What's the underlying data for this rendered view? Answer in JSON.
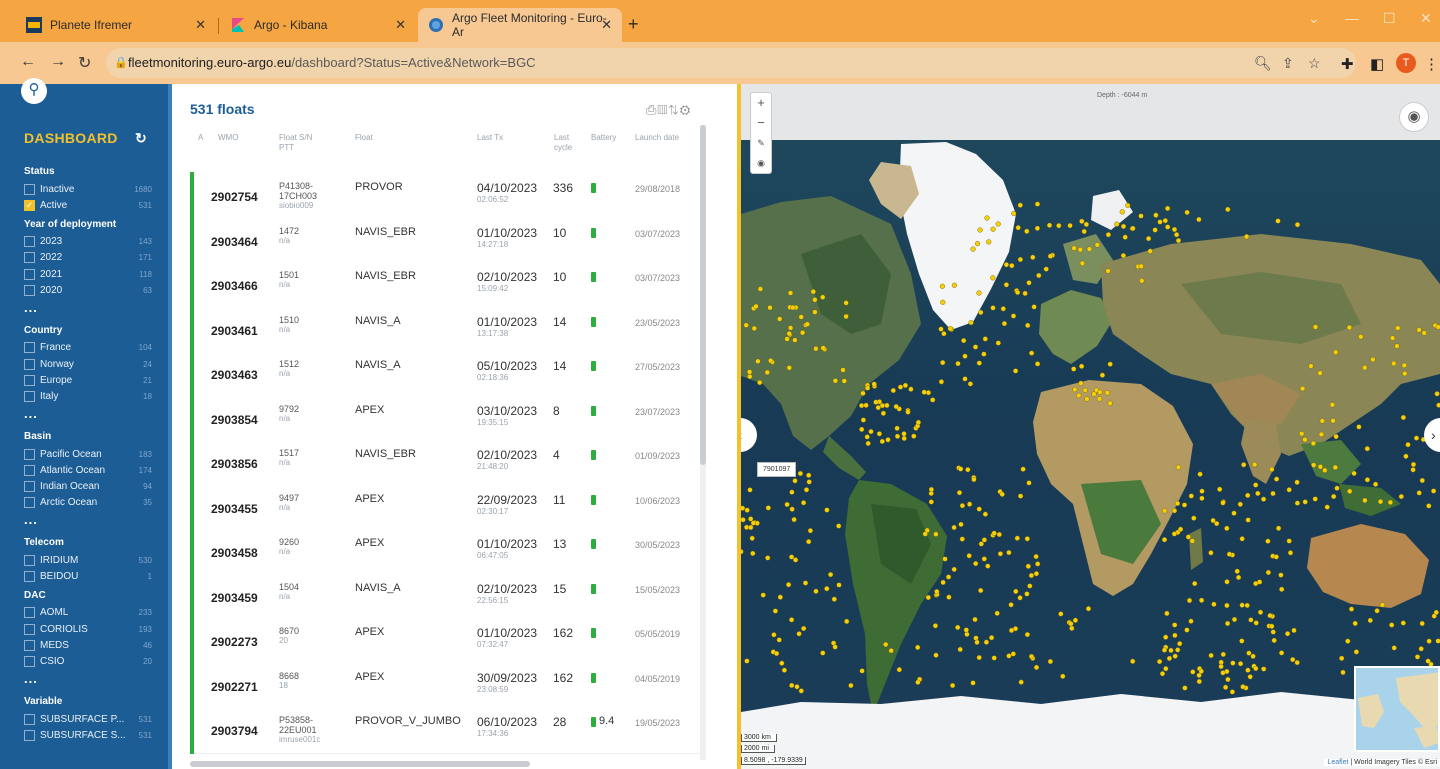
{
  "browser": {
    "tabs": [
      {
        "title": "Planete Ifremer",
        "active": false
      },
      {
        "title": "Argo - Kibana",
        "active": false
      },
      {
        "title": "Argo Fleet Monitoring - Euro-Ar",
        "active": true
      }
    ],
    "url_host": "fleetmonitoring.euro-argo.eu",
    "url_path": "/dashboard?Status=Active&Network=BGC",
    "profile_initial": "T"
  },
  "sidebar": {
    "title": "DASHBOARD",
    "groups": [
      {
        "label": "Status",
        "items": [
          {
            "label": "Inactive",
            "count": "1680",
            "checked": false
          },
          {
            "label": "Active",
            "count": "531",
            "checked": true
          }
        ]
      },
      {
        "label": "Year of deployment",
        "items": [
          {
            "label": "2023",
            "count": "143",
            "checked": false
          },
          {
            "label": "2022",
            "count": "171",
            "checked": false
          },
          {
            "label": "2021",
            "count": "118",
            "checked": false
          },
          {
            "label": "2020",
            "count": "63",
            "checked": false
          }
        ]
      },
      {
        "label": "Country",
        "items": [
          {
            "label": "France",
            "count": "104",
            "checked": false
          },
          {
            "label": "Norway",
            "count": "24",
            "checked": false
          },
          {
            "label": "Europe",
            "count": "21",
            "checked": false
          },
          {
            "label": "Italy",
            "count": "18",
            "checked": false
          }
        ]
      },
      {
        "label": "Basin",
        "items": [
          {
            "label": "Pacific Ocean",
            "count": "183",
            "checked": false
          },
          {
            "label": "Atlantic Ocean",
            "count": "174",
            "checked": false
          },
          {
            "label": "Indian Ocean",
            "count": "94",
            "checked": false
          },
          {
            "label": "Arctic Ocean",
            "count": "35",
            "checked": false
          }
        ]
      },
      {
        "label": "Telecom",
        "items": [
          {
            "label": "IRIDIUM",
            "count": "530",
            "checked": false
          },
          {
            "label": "BEIDOU",
            "count": "1",
            "checked": false
          }
        ]
      },
      {
        "label": "DAC",
        "items": [
          {
            "label": "AOML",
            "count": "233",
            "checked": false
          },
          {
            "label": "CORIOLIS",
            "count": "193",
            "checked": false
          },
          {
            "label": "MEDS",
            "count": "46",
            "checked": false
          },
          {
            "label": "CSIO",
            "count": "20",
            "checked": false
          }
        ]
      },
      {
        "label": "Variable",
        "items": [
          {
            "label": "SUBSURFACE P...",
            "count": "531",
            "checked": false
          },
          {
            "label": "SUBSURFACE S...",
            "count": "531",
            "checked": false
          }
        ]
      }
    ],
    "more_label": "..."
  },
  "list": {
    "title": "531 floats",
    "columns": [
      "A",
      "WMO",
      "Float S/N",
      "PTT",
      "Float",
      "Last Tx",
      "Last",
      "cycle",
      "Battery",
      "Launch date"
    ],
    "rows": [
      {
        "wmo": "2902754",
        "sn": "P41308-",
        "sn2": "17CH003",
        "ptt": "siobio009",
        "float": "PROVOR",
        "last_tx": "04/10/2023",
        "last_tx_time": "02:06:52",
        "cycle": "336",
        "battery": "",
        "launch": "29/08/2018"
      },
      {
        "wmo": "2903464",
        "sn": "1472",
        "sn2": "",
        "ptt": "n/a",
        "float": "NAVIS_EBR",
        "last_tx": "01/10/2023",
        "last_tx_time": "14:27:18",
        "cycle": "10",
        "battery": "",
        "launch": "03/07/2023"
      },
      {
        "wmo": "2903466",
        "sn": "1501",
        "sn2": "",
        "ptt": "n/a",
        "float": "NAVIS_EBR",
        "last_tx": "02/10/2023",
        "last_tx_time": "15:09:42",
        "cycle": "10",
        "battery": "",
        "launch": "03/07/2023"
      },
      {
        "wmo": "2903461",
        "sn": "1510",
        "sn2": "",
        "ptt": "n/a",
        "float": "NAVIS_A",
        "last_tx": "01/10/2023",
        "last_tx_time": "13:17:38",
        "cycle": "14",
        "battery": "",
        "launch": "23/05/2023"
      },
      {
        "wmo": "2903463",
        "sn": "1512",
        "sn2": "",
        "ptt": "n/a",
        "float": "NAVIS_A",
        "last_tx": "05/10/2023",
        "last_tx_time": "02:18:36",
        "cycle": "14",
        "battery": "",
        "launch": "27/05/2023"
      },
      {
        "wmo": "2903854",
        "sn": "9792",
        "sn2": "",
        "ptt": "n/a",
        "float": "APEX",
        "last_tx": "03/10/2023",
        "last_tx_time": "19:35:15",
        "cycle": "8",
        "battery": "",
        "launch": "23/07/2023"
      },
      {
        "wmo": "2903856",
        "sn": "1517",
        "sn2": "",
        "ptt": "n/a",
        "float": "NAVIS_EBR",
        "last_tx": "02/10/2023",
        "last_tx_time": "21:48:20",
        "cycle": "4",
        "battery": "",
        "launch": "01/09/2023"
      },
      {
        "wmo": "2903455",
        "sn": "9497",
        "sn2": "",
        "ptt": "n/a",
        "float": "APEX",
        "last_tx": "22/09/2023",
        "last_tx_time": "02:30:17",
        "cycle": "11",
        "battery": "",
        "launch": "10/06/2023"
      },
      {
        "wmo": "2903458",
        "sn": "9260",
        "sn2": "",
        "ptt": "n/a",
        "float": "APEX",
        "last_tx": "01/10/2023",
        "last_tx_time": "06:47:05",
        "cycle": "13",
        "battery": "",
        "launch": "30/05/2023"
      },
      {
        "wmo": "2903459",
        "sn": "1504",
        "sn2": "",
        "ptt": "n/a",
        "float": "NAVIS_A",
        "last_tx": "02/10/2023",
        "last_tx_time": "22:56:15",
        "cycle": "15",
        "battery": "",
        "launch": "15/05/2023"
      },
      {
        "wmo": "2902273",
        "sn": "8670",
        "sn2": "",
        "ptt": "20",
        "float": "APEX",
        "last_tx": "01/10/2023",
        "last_tx_time": "07:32:47",
        "cycle": "162",
        "battery": "",
        "launch": "05/05/2019"
      },
      {
        "wmo": "2902271",
        "sn": "8668",
        "sn2": "",
        "ptt": "18",
        "float": "APEX",
        "last_tx": "30/09/2023",
        "last_tx_time": "23:08:59",
        "cycle": "162",
        "battery": "",
        "launch": "04/05/2019"
      },
      {
        "wmo": "2903794",
        "sn": "P53858-",
        "sn2": "22EU001",
        "ptt": "imruse001c",
        "float": "PROVOR_V_JUMBO",
        "last_tx": "06/10/2023",
        "last_tx_time": "17:34:36",
        "cycle": "28",
        "battery": "9.4",
        "launch": "19/05/2023"
      }
    ]
  },
  "map": {
    "depth_label": "Depth : -6044 m",
    "tooltip": "7901097",
    "scale_km": "3000 km",
    "scale_mi": "2000 mi",
    "coords": "8.5098 , -179.9339",
    "attribution_link": "Leaflet",
    "attribution_text": "| World Imagery Tiles © Esri"
  },
  "colors": {
    "tabbar": "#f5a541",
    "sidebar": "#1d5d96",
    "accent_yellow": "#f3c22a",
    "active_green": "#2dad3e",
    "float_marker": "#f6cf0b"
  }
}
